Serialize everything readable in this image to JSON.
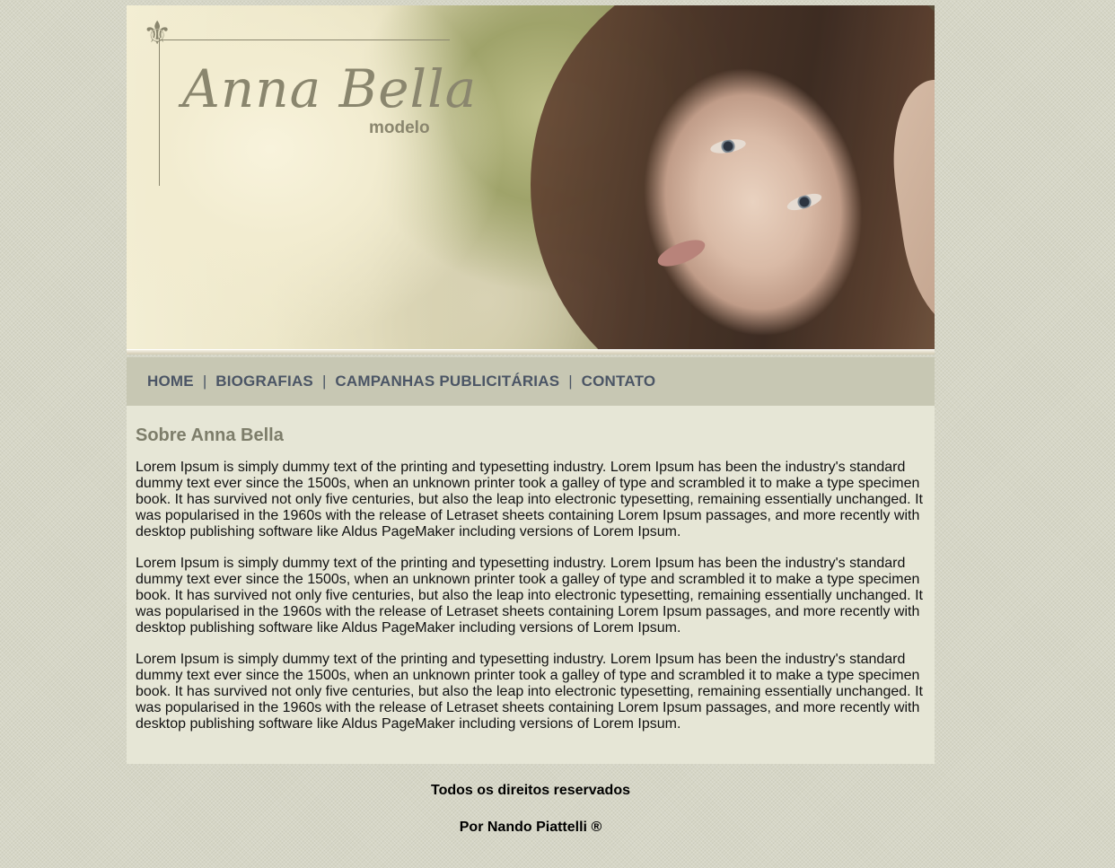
{
  "banner": {
    "logo_name": "Anna Bella",
    "logo_subtitle": "modelo",
    "decor_icon": "fleur-de-lis-icon",
    "photo_alt": "model-portrait"
  },
  "nav": {
    "items": [
      {
        "label": "HOME"
      },
      {
        "label": "BIOGRAFIAS"
      },
      {
        "label": "CAMPANHAS PUBLICITÁRIAS"
      },
      {
        "label": "CONTATO"
      }
    ],
    "separator": "|"
  },
  "main": {
    "heading": "Sobre Anna Bella",
    "paragraphs": [
      "Lorem Ipsum is simply dummy text of the printing and typesetting industry. Lorem Ipsum has been the industry's standard dummy text ever since the 1500s, when an unknown printer took a galley of type and scrambled it to make a type specimen book. It has survived not only five centuries, but also the leap into electronic typesetting, remaining essentially unchanged. It was popularised in the 1960s with the release of Letraset sheets containing Lorem Ipsum passages, and more recently with desktop publishing software like Aldus PageMaker including versions of Lorem Ipsum.",
      "Lorem Ipsum is simply dummy text of the printing and typesetting industry. Lorem Ipsum has been the industry's standard dummy text ever since the 1500s, when an unknown printer took a galley of type and scrambled it to make a type specimen book. It has survived not only five centuries, but also the leap into electronic typesetting, remaining essentially unchanged. It was popularised in the 1960s with the release of Letraset sheets containing Lorem Ipsum passages, and more recently with desktop publishing software like Aldus PageMaker including versions of Lorem Ipsum.",
      "Lorem Ipsum is simply dummy text of the printing and typesetting industry. Lorem Ipsum has been the industry's standard dummy text ever since the 1500s, when an unknown printer took a galley of type and scrambled it to make a type specimen book. It has survived not only five centuries, but also the leap into electronic typesetting, remaining essentially unchanged. It was popularised in the 1960s with the release of Letraset sheets containing Lorem Ipsum passages, and more recently with desktop publishing software like Aldus PageMaker including versions of Lorem Ipsum."
    ]
  },
  "footer": {
    "rights": "Todos os direitos reservados",
    "author": "Por Nando Piattelli ®"
  },
  "colors": {
    "page_bg": "#d6d6c6",
    "nav_bg": "#c7c7b3",
    "nav_text": "#4b5565",
    "content_bg": "#e6e6d6",
    "heading": "#7d7d6a",
    "logo": "#8a866e"
  }
}
